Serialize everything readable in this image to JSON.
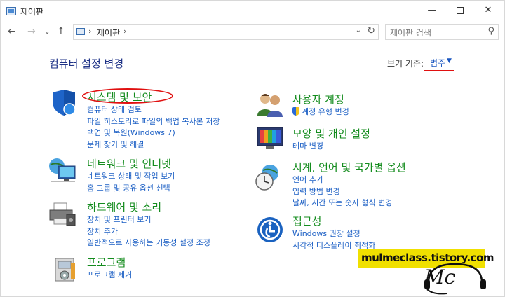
{
  "window": {
    "title": "제어판",
    "minimize_glyph": "—",
    "close_glyph": "✕"
  },
  "nav": {
    "back_glyph": "←",
    "forward_glyph": "→",
    "recent_glyph": "⌄",
    "up_glyph": "↑",
    "address_sep": "›",
    "address_path": "제어판",
    "address_drop_glyph": "⌄",
    "refresh_glyph": "↻",
    "search_placeholder": "제어판 검색",
    "search_glyph": "⚲"
  },
  "header": {
    "title": "컴퓨터 설정 변경",
    "view_by_label": "보기 기준:",
    "view_by_value": "범주",
    "view_by_arrow": "▼"
  },
  "categories_left": [
    {
      "title": "시스템 및 보안",
      "icon": "shield-icon",
      "links": [
        "컴퓨터 상태 검토",
        "파일 히스토리로 파일의 백업 복사본 저장",
        "백업 및 복원(Windows 7)",
        "문제 찾기 및 해결"
      ]
    },
    {
      "title": "네트워크 및 인터넷",
      "icon": "network-icon",
      "links": [
        "네트워크 상태 및 작업 보기",
        "홈 그룹 및 공유 옵션 선택"
      ]
    },
    {
      "title": "하드웨어 및 소리",
      "icon": "printer-icon",
      "links": [
        "장치 및 프린터 보기",
        "장치 추가",
        "일반적으로 사용하는 기동성 설정 조정"
      ]
    },
    {
      "title": "프로그램",
      "icon": "programs-icon",
      "links": [
        "프로그램 제거"
      ]
    }
  ],
  "categories_right": [
    {
      "title": "사용자 계정",
      "icon": "users-icon",
      "links": [
        "계정 유형 변경"
      ]
    },
    {
      "title": "모양 및 개인 설정",
      "icon": "appearance-icon",
      "links": [
        "테마 변경"
      ]
    },
    {
      "title": "시계, 언어 및 국가별 옵션",
      "icon": "clock-globe-icon",
      "links": [
        "언어 추가",
        "입력 방법 변경",
        "날짜, 시간 또는 숫자 형식 변경"
      ]
    },
    {
      "title": "접근성",
      "icon": "accessibility-icon",
      "links": [
        "Windows 권장 설정",
        "시각적 디스플레이 최적화"
      ]
    }
  ],
  "watermark": {
    "site": "mulmeclass.tistory.com",
    "logo": "Mc"
  },
  "colors": {
    "category_title": "#148c1e",
    "link": "#1a5ec4",
    "heading": "#1e3287",
    "annotation_red": "#e01010",
    "watermark_bg": "#f0e000"
  }
}
